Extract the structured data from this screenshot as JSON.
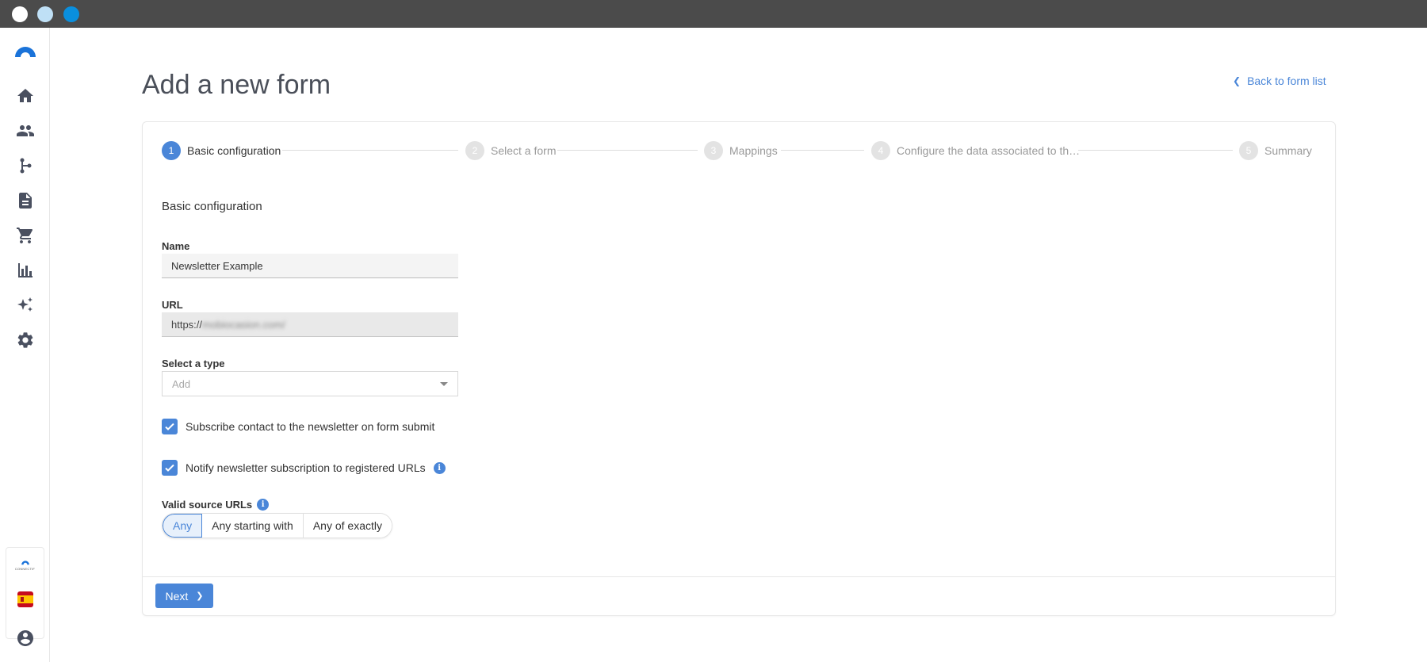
{
  "page": {
    "title": "Add a new form",
    "back_link": "Back to form list"
  },
  "stepper": [
    {
      "num": "1",
      "label": "Basic configuration",
      "state": "active"
    },
    {
      "num": "2",
      "label": "Select a form",
      "state": "inactive"
    },
    {
      "num": "3",
      "label": "Mappings",
      "state": "inactive"
    },
    {
      "num": "4",
      "label": "Configure the data associated to th…",
      "state": "inactive"
    },
    {
      "num": "5",
      "label": "Summary",
      "state": "inactive"
    }
  ],
  "form": {
    "section_title": "Basic configuration",
    "name_label": "Name",
    "name_value": "Newsletter Example",
    "url_label": "URL",
    "url_prefix": "https://",
    "url_blurred": "mobiocasion.com/",
    "type_label": "Select a type",
    "type_placeholder": "Add",
    "subscribe_label": "Subscribe contact to the newsletter on form submit",
    "subscribe_checked": true,
    "notify_label": "Notify newsletter subscription to registered URLs",
    "notify_checked": true,
    "valid_urls_label": "Valid source URLs",
    "valid_urls_options": [
      "Any",
      "Any starting with",
      "Any of exactly"
    ],
    "valid_urls_selected": "Any"
  },
  "footer": {
    "next_label": "Next"
  },
  "sidebar": {
    "items": [
      "home-icon",
      "contacts-icon",
      "flow-icon",
      "document-icon",
      "cart-icon",
      "analytics-icon",
      "sparkle-icon",
      "settings-icon"
    ],
    "brand_text": "CONNECTIF",
    "language": "es"
  },
  "colors": {
    "accent": "#4a86d8",
    "titlebar": "#4b4b4b"
  }
}
